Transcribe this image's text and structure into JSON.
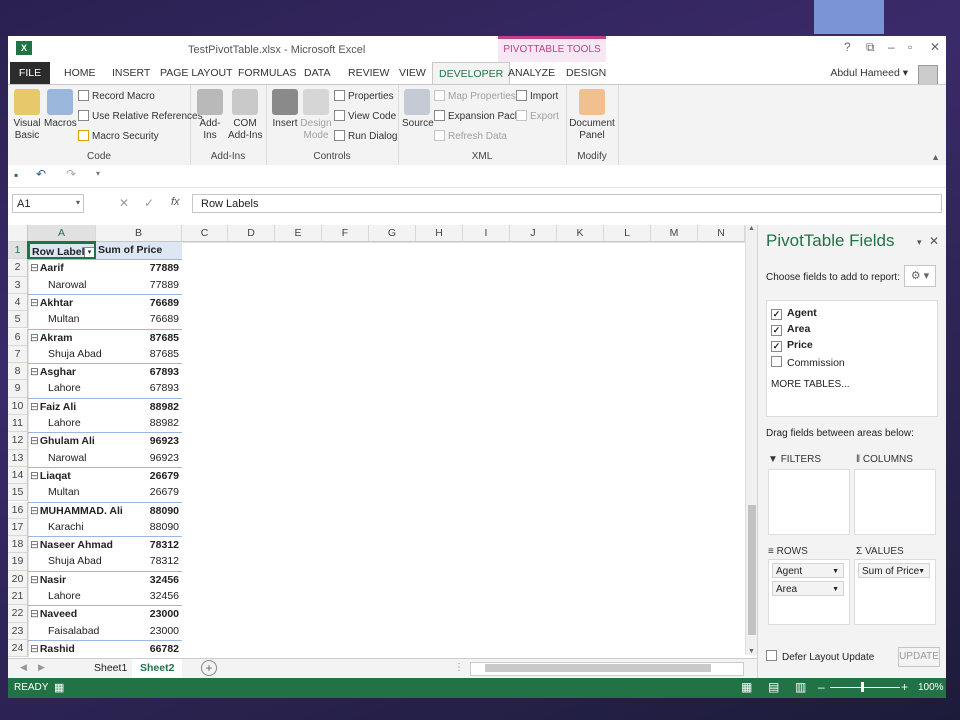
{
  "window": {
    "title": "TestPivotTable.xlsx - Microsoft Excel",
    "contextual_group": "PIVOTTABLE TOOLS",
    "controls": [
      "?",
      "⧉",
      "–",
      "▫",
      "✕"
    ],
    "user": "Abdul Hameed ▾"
  },
  "tabs": [
    "FILE",
    "HOME",
    "INSERT",
    "PAGE LAYOUT",
    "FORMULAS",
    "DATA",
    "REVIEW",
    "VIEW",
    "DEVELOPER",
    "ANALYZE",
    "DESIGN"
  ],
  "active_tab": "DEVELOPER",
  "ribbon": {
    "code": {
      "label": "Code",
      "visual_basic": "Visual\nBasic",
      "macros": "Macros",
      "record_macro": "Record Macro",
      "relative_refs": "Use Relative References",
      "macro_security": "Macro Security"
    },
    "addins": {
      "label": "Add-Ins",
      "addins": "Add-Ins",
      "com_addins": "COM\nAdd-Ins"
    },
    "controls": {
      "label": "Controls",
      "insert": "Insert",
      "design_mode": "Design\nMode",
      "properties": "Properties",
      "view_code": "View Code",
      "run_dialog": "Run Dialog"
    },
    "xml": {
      "label": "XML",
      "source": "Source",
      "map_properties": "Map Properties",
      "expansion_packs": "Expansion Packs",
      "refresh_data": "Refresh Data",
      "import": "Import",
      "export": "Export"
    },
    "modify": {
      "label": "Modify",
      "document_panel": "Document\nPanel"
    }
  },
  "formula_bar": {
    "name_box": "A1",
    "fx": "fx",
    "content": "Row Labels"
  },
  "columns": [
    "A",
    "B",
    "C",
    "D",
    "E",
    "F",
    "G",
    "H",
    "I",
    "J",
    "K",
    "L",
    "M",
    "N"
  ],
  "pivot": {
    "header": {
      "row_labels": "Row Labels",
      "sum": "Sum of Price"
    },
    "rows": [
      {
        "label": "Aarif",
        "value": "77889",
        "level": 0
      },
      {
        "label": "Narowal",
        "value": "77889",
        "level": 1
      },
      {
        "label": "Akhtar",
        "value": "76689",
        "level": 0
      },
      {
        "label": "Multan",
        "value": "76689",
        "level": 1
      },
      {
        "label": "Akram",
        "value": "87685",
        "level": 0
      },
      {
        "label": "Shuja Abad",
        "value": "87685",
        "level": 1
      },
      {
        "label": "Asghar",
        "value": "67893",
        "level": 0
      },
      {
        "label": "Lahore",
        "value": "67893",
        "level": 1
      },
      {
        "label": "Faiz Ali",
        "value": "88982",
        "level": 0
      },
      {
        "label": "Lahore",
        "value": "88982",
        "level": 1
      },
      {
        "label": "Ghulam Ali",
        "value": "96923",
        "level": 0
      },
      {
        "label": "Narowal",
        "value": "96923",
        "level": 1
      },
      {
        "label": "Liaqat",
        "value": "26679",
        "level": 0
      },
      {
        "label": "Multan",
        "value": "26679",
        "level": 1
      },
      {
        "label": "MUHAMMAD. Ali",
        "value": "88090",
        "level": 0
      },
      {
        "label": "Karachi",
        "value": "88090",
        "level": 1
      },
      {
        "label": "Naseer Ahmad",
        "value": "78312",
        "level": 0
      },
      {
        "label": "Shuja Abad",
        "value": "78312",
        "level": 1
      },
      {
        "label": "Nasir",
        "value": "32456",
        "level": 0
      },
      {
        "label": "Lahore",
        "value": "32456",
        "level": 1
      },
      {
        "label": "Naveed",
        "value": "23000",
        "level": 0
      },
      {
        "label": "Faisalabad",
        "value": "23000",
        "level": 1
      },
      {
        "label": "Rashid",
        "value": "66782",
        "level": 0
      }
    ]
  },
  "sheets": [
    "Sheet1",
    "Sheet2"
  ],
  "active_sheet": "Sheet2",
  "status": {
    "mode": "READY",
    "zoom": "100%"
  },
  "pane": {
    "title": "PivotTable Fields",
    "choose_label": "Choose fields to add to report:",
    "fields": [
      {
        "name": "Agent",
        "checked": true
      },
      {
        "name": "Area",
        "checked": true
      },
      {
        "name": "Price",
        "checked": true
      },
      {
        "name": "Commission",
        "checked": false
      }
    ],
    "more_tables": "MORE TABLES...",
    "drag_label": "Drag fields between areas below:",
    "filters": "FILTERS",
    "columns": "COLUMNS",
    "rows": "ROWS",
    "values": "VALUES",
    "row_fields": [
      "Agent",
      "Area"
    ],
    "value_fields": [
      "Sum of Price"
    ],
    "defer": "Defer Layout Update",
    "update": "UPDATE"
  }
}
